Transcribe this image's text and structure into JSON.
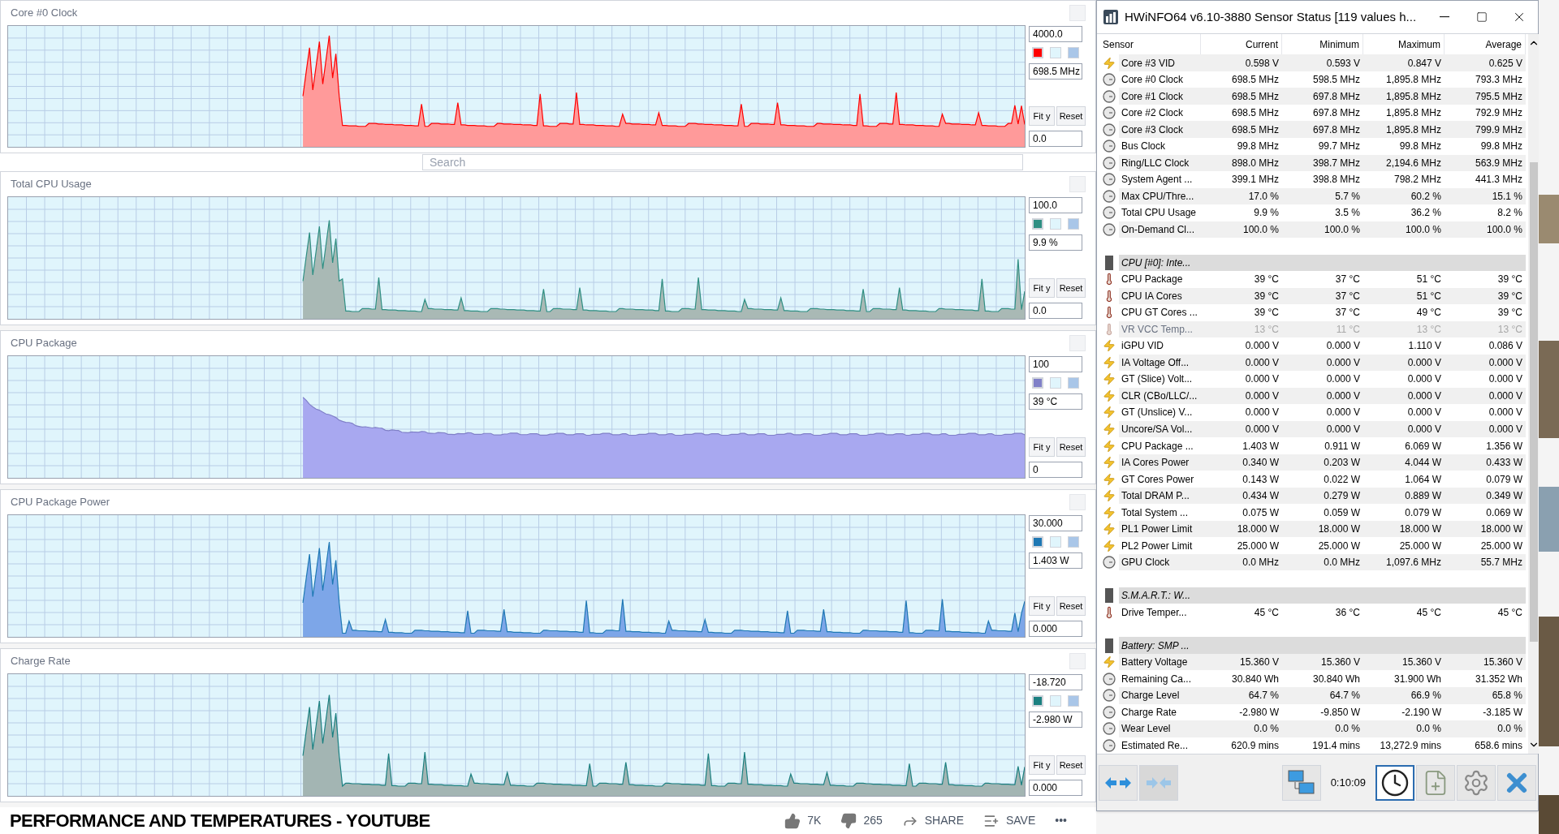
{
  "graphs": [
    {
      "title": "Core #0 Clock",
      "max": "4000.0",
      "current": "698.5 MHz",
      "min": "0.0",
      "color": "#ff0000",
      "fit": "Fit y",
      "reset": "Reset"
    },
    {
      "title": "Total CPU Usage",
      "max": "100.0",
      "current": "9.9 %",
      "min": "0.0",
      "color": "#2f8f83",
      "fit": "Fit y",
      "reset": "Reset"
    },
    {
      "title": "CPU Package",
      "max": "100",
      "current": "39 °C",
      "min": "0",
      "color": "#8080c8",
      "fit": "Fit y",
      "reset": "Reset"
    },
    {
      "title": "CPU Package Power",
      "max": "30.000",
      "current": "1.403 W",
      "min": "0.000",
      "color": "#1e78b4",
      "fit": "Fit y",
      "reset": "Reset"
    },
    {
      "title": "Charge Rate",
      "max": "-18.720",
      "current": "-2.980 W",
      "min": "0.000",
      "color": "#1b8080",
      "fit": "Fit y",
      "reset": "Reset"
    }
  ],
  "youtube": {
    "search": {
      "placeholder": "Search"
    },
    "video_title": "PERFORMANCE AND TEMPERATURES - YOUTUBE",
    "likes": "7K",
    "dislikes": "265",
    "share": "SHARE",
    "save": "SAVE",
    "more": "•••"
  },
  "hwinfo": {
    "title": "HWiNFO64 v6.10-3880 Sensor Status [119 values h...",
    "columns": [
      "Sensor",
      "Current",
      "Minimum",
      "Maximum",
      "Average"
    ],
    "rows": [
      {
        "kind": "voltage",
        "name": "Core #3 VID",
        "current": "0.598 V",
        "minimum": "0.593 V",
        "maximum": "0.847 V",
        "average": "0.625 V",
        "disabled": false
      },
      {
        "kind": "clock",
        "name": "Core #0 Clock",
        "current": "698.5 MHz",
        "minimum": "598.5 MHz",
        "maximum": "1,895.8 MHz",
        "average": "793.3 MHz",
        "disabled": false
      },
      {
        "kind": "clock",
        "name": "Core #1 Clock",
        "current": "698.5 MHz",
        "minimum": "697.8 MHz",
        "maximum": "1,895.8 MHz",
        "average": "795.5 MHz",
        "disabled": false
      },
      {
        "kind": "clock",
        "name": "Core #2 Clock",
        "current": "698.5 MHz",
        "minimum": "697.8 MHz",
        "maximum": "1,895.8 MHz",
        "average": "792.9 MHz",
        "disabled": false
      },
      {
        "kind": "clock",
        "name": "Core #3 Clock",
        "current": "698.5 MHz",
        "minimum": "697.8 MHz",
        "maximum": "1,895.8 MHz",
        "average": "799.9 MHz",
        "disabled": false
      },
      {
        "kind": "clock",
        "name": "Bus Clock",
        "current": "99.8 MHz",
        "minimum": "99.7 MHz",
        "maximum": "99.8 MHz",
        "average": "99.8 MHz",
        "disabled": false
      },
      {
        "kind": "clock",
        "name": "Ring/LLC Clock",
        "current": "898.0 MHz",
        "minimum": "398.7 MHz",
        "maximum": "2,194.6 MHz",
        "average": "563.9 MHz",
        "disabled": false
      },
      {
        "kind": "clock",
        "name": "System Agent ...",
        "current": "399.1 MHz",
        "minimum": "398.8 MHz",
        "maximum": "798.2 MHz",
        "average": "441.3 MHz",
        "disabled": false
      },
      {
        "kind": "clock",
        "name": "Max CPU/Thre...",
        "current": "17.0 %",
        "minimum": "5.7 %",
        "maximum": "60.2 %",
        "average": "15.1 %",
        "disabled": false
      },
      {
        "kind": "clock",
        "name": "Total CPU Usage",
        "current": "9.9 %",
        "minimum": "3.5 %",
        "maximum": "36.2 %",
        "average": "8.2 %",
        "disabled": false
      },
      {
        "kind": "clock",
        "name": "On-Demand Cl...",
        "current": "100.0 %",
        "minimum": "100.0 %",
        "maximum": "100.0 %",
        "average": "100.0 %",
        "disabled": false
      },
      {
        "kind": "blank"
      },
      {
        "kind": "group",
        "name": "CPU [#0]: Inte..."
      },
      {
        "kind": "temperature",
        "name": "CPU Package",
        "current": "39 °C",
        "minimum": "37 °C",
        "maximum": "51 °C",
        "average": "39 °C",
        "disabled": false
      },
      {
        "kind": "temperature",
        "name": "CPU IA Cores",
        "current": "39 °C",
        "minimum": "37 °C",
        "maximum": "51 °C",
        "average": "39 °C",
        "disabled": false
      },
      {
        "kind": "temperature",
        "name": "CPU GT Cores ...",
        "current": "39 °C",
        "minimum": "37 °C",
        "maximum": "49 °C",
        "average": "39 °C",
        "disabled": false
      },
      {
        "kind": "temperature",
        "name": "VR VCC Temp...",
        "current": "13 °C",
        "minimum": "11 °C",
        "maximum": "13 °C",
        "average": "13 °C",
        "disabled": true
      },
      {
        "kind": "voltage",
        "name": "iGPU VID",
        "current": "0.000 V",
        "minimum": "0.000 V",
        "maximum": "1.110 V",
        "average": "0.086 V",
        "disabled": false
      },
      {
        "kind": "voltage",
        "name": "IA Voltage Off...",
        "current": "0.000 V",
        "minimum": "0.000 V",
        "maximum": "0.000 V",
        "average": "0.000 V",
        "disabled": false
      },
      {
        "kind": "voltage",
        "name": "GT (Slice) Volt...",
        "current": "0.000 V",
        "minimum": "0.000 V",
        "maximum": "0.000 V",
        "average": "0.000 V",
        "disabled": false
      },
      {
        "kind": "voltage",
        "name": "CLR (CBo/LLC/...",
        "current": "0.000 V",
        "minimum": "0.000 V",
        "maximum": "0.000 V",
        "average": "0.000 V",
        "disabled": false
      },
      {
        "kind": "voltage",
        "name": "GT (Unslice) V...",
        "current": "0.000 V",
        "minimum": "0.000 V",
        "maximum": "0.000 V",
        "average": "0.000 V",
        "disabled": false
      },
      {
        "kind": "voltage",
        "name": "Uncore/SA Vol...",
        "current": "0.000 V",
        "minimum": "0.000 V",
        "maximum": "0.000 V",
        "average": "0.000 V",
        "disabled": false
      },
      {
        "kind": "voltage",
        "name": "CPU Package ...",
        "current": "1.403 W",
        "minimum": "0.911 W",
        "maximum": "6.069 W",
        "average": "1.356 W",
        "disabled": false
      },
      {
        "kind": "voltage",
        "name": "IA Cores Power",
        "current": "0.340 W",
        "minimum": "0.203 W",
        "maximum": "4.044 W",
        "average": "0.433 W",
        "disabled": false
      },
      {
        "kind": "voltage",
        "name": "GT Cores Power",
        "current": "0.143 W",
        "minimum": "0.022 W",
        "maximum": "1.064 W",
        "average": "0.079 W",
        "disabled": false
      },
      {
        "kind": "voltage",
        "name": "Total DRAM P...",
        "current": "0.434 W",
        "minimum": "0.279 W",
        "maximum": "0.889 W",
        "average": "0.349 W",
        "disabled": false
      },
      {
        "kind": "voltage",
        "name": "Total System ...",
        "current": "0.075 W",
        "minimum": "0.059 W",
        "maximum": "0.079 W",
        "average": "0.069 W",
        "disabled": false
      },
      {
        "kind": "voltage",
        "name": "PL1 Power Limit",
        "current": "18.000 W",
        "minimum": "18.000 W",
        "maximum": "18.000 W",
        "average": "18.000 W",
        "disabled": false
      },
      {
        "kind": "voltage",
        "name": "PL2 Power Limit",
        "current": "25.000 W",
        "minimum": "25.000 W",
        "maximum": "25.000 W",
        "average": "25.000 W",
        "disabled": false
      },
      {
        "kind": "clock",
        "name": "GPU Clock",
        "current": "0.0 MHz",
        "minimum": "0.0 MHz",
        "maximum": "1,097.6 MHz",
        "average": "55.7 MHz",
        "disabled": false
      },
      {
        "kind": "blank"
      },
      {
        "kind": "group",
        "name": "S.M.A.R.T.: W..."
      },
      {
        "kind": "temperature",
        "name": "Drive Temper...",
        "current": "45 °C",
        "minimum": "36 °C",
        "maximum": "45 °C",
        "average": "45 °C",
        "disabled": false
      },
      {
        "kind": "blank"
      },
      {
        "kind": "group",
        "name": "Battery: SMP ..."
      },
      {
        "kind": "voltage",
        "name": "Battery Voltage",
        "current": "15.360 V",
        "minimum": "15.360 V",
        "maximum": "15.360 V",
        "average": "15.360 V",
        "disabled": false
      },
      {
        "kind": "clock",
        "name": "Remaining Ca...",
        "current": "30.840 Wh",
        "minimum": "30.840 Wh",
        "maximum": "31.900 Wh",
        "average": "31.352 Wh",
        "disabled": false
      },
      {
        "kind": "clock",
        "name": "Charge Level",
        "current": "64.7 %",
        "minimum": "64.7 %",
        "maximum": "66.9 %",
        "average": "65.8 %",
        "disabled": false
      },
      {
        "kind": "clock",
        "name": "Charge Rate",
        "current": "-2.980 W",
        "minimum": "-9.850 W",
        "maximum": "-2.190 W",
        "average": "-3.185 W",
        "disabled": false
      },
      {
        "kind": "clock",
        "name": "Wear Level",
        "current": "0.0 %",
        "minimum": "0.0 %",
        "maximum": "0.0 %",
        "average": "0.0 %",
        "disabled": false
      },
      {
        "kind": "clock",
        "name": "Estimated Re...",
        "current": "620.9 mins",
        "minimum": "191.4 mins",
        "maximum": "13,272.9 mins",
        "average": "658.6 mins",
        "disabled": false
      }
    ],
    "toolbar": {
      "left": [
        {
          "kind": "expand",
          "disabled": false
        },
        {
          "kind": "collapse",
          "disabled": true
        }
      ],
      "network": {
        "kind": "network"
      },
      "timer": "0:10:09",
      "right": [
        {
          "kind": "clock",
          "selected": true
        },
        {
          "kind": "report",
          "selected": false
        },
        {
          "kind": "settings",
          "selected": false
        },
        {
          "kind": "close",
          "selected": false
        }
      ]
    }
  }
}
